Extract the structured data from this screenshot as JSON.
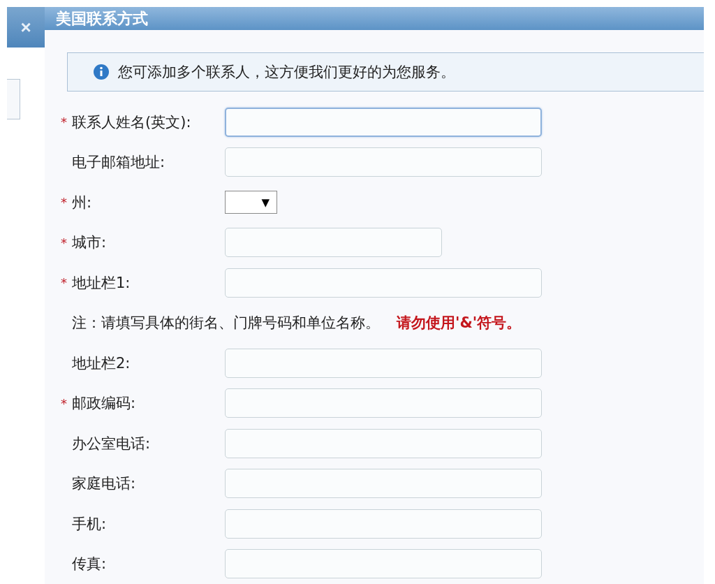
{
  "dialog": {
    "title": "美国联系方式",
    "close": "×"
  },
  "info": {
    "text": "您可添加多个联系人，这方便我们更好的为您服务。"
  },
  "rows": [
    {
      "kind": "text",
      "mark": "*",
      "label": "联系人姓名(英文):",
      "focused": true
    },
    {
      "kind": "text",
      "label": "电子邮箱地址:",
      "focused": false
    },
    {
      "kind": "select",
      "mark": "*",
      "label": "州:",
      "caret": "▼"
    },
    {
      "kind": "short_text",
      "mark": "*",
      "label": "城市:",
      "focused": false
    },
    {
      "kind": "text",
      "mark": "*",
      "label": "地址栏1:",
      "focused": false
    },
    {
      "kind": "note",
      "text": "注：请填写具体的街名、门牌号码和单位名称。",
      "warning": "请勿使用'&'符号。"
    },
    {
      "kind": "text",
      "label": "地址栏2:",
      "focused": false
    },
    {
      "kind": "text",
      "mark": "*",
      "label": "邮政编码:",
      "focused": false
    },
    {
      "kind": "text",
      "label": "办公室电话:",
      "focused": false
    },
    {
      "kind": "text",
      "label": "家庭电话:",
      "focused": false
    },
    {
      "kind": "text",
      "label": "手机:",
      "focused": false
    },
    {
      "kind": "text",
      "label": "传真:",
      "focused": false
    }
  ]
}
